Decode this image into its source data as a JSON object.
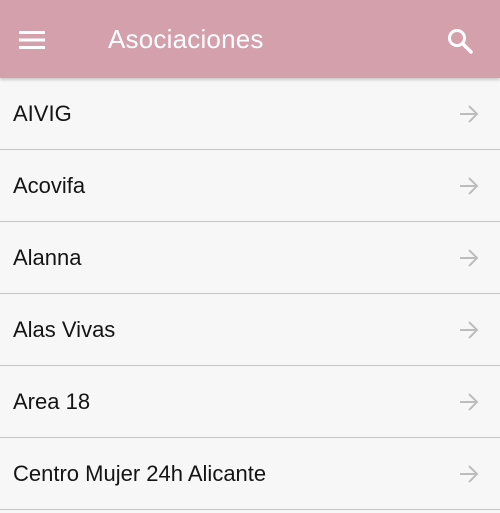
{
  "app_bar": {
    "title": "Asociaciones",
    "background_color": "#d3a0ac",
    "menu_icon": "menu-icon",
    "search_icon": "search-icon"
  },
  "list": {
    "divider_color": "#e2b7c0",
    "item_icon": "arrow-right-icon",
    "items": [
      {
        "label": "AIVIG"
      },
      {
        "label": "Acovifa"
      },
      {
        "label": "Alanna"
      },
      {
        "label": "Alas Vivas"
      },
      {
        "label": "Area 18"
      },
      {
        "label": "Centro Mujer 24h Alicante"
      }
    ]
  }
}
